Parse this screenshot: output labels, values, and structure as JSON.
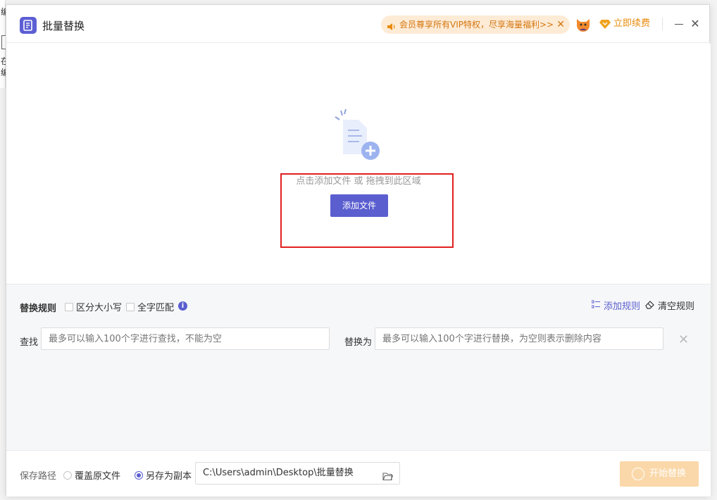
{
  "background": {
    "char_top": "编",
    "char_mid1": "在",
    "char_mid2": "编"
  },
  "titlebar": {
    "title": "批量替换",
    "vip_banner": "会员尊享所有VIP特权，尽享海量福利>>",
    "renew_label": "立即续费",
    "icons": [
      "app-doc-icon",
      "speaker-icon",
      "close-icon",
      "avatar-icon",
      "diamond-icon",
      "minimize-icon",
      "close-icon"
    ]
  },
  "drop_area": {
    "hint": "点击添加文件 或 拖拽到此区域",
    "add_button": "添加文件"
  },
  "rules": {
    "title": "替换规则",
    "case_sensitive": "区分大小写",
    "whole_word": "全字匹配",
    "info_glyph": "i",
    "add_rule": "添加规则",
    "clear_rule": "清空规则",
    "find_label": "查找",
    "find_placeholder": "最多可以输入100个字进行查找，不能为空",
    "replace_label": "替换为",
    "replace_placeholder": "最多可以输入100个字进行替换，为空则表示删除内容"
  },
  "footer": {
    "save_path_label": "保存路径",
    "option_overwrite": "覆盖原文件",
    "option_copy": "另存为副本",
    "selected_option": "另存为副本",
    "path": "C:\\Users\\admin\\Desktop\\批量替换",
    "start_button": "开始替换"
  },
  "colors": {
    "accent": "#5b5ecf",
    "vip_text": "#d4760f",
    "vip_bg": "#fdebd6",
    "start_disabled": "#fbd8a9",
    "highlight": "#e12020"
  }
}
